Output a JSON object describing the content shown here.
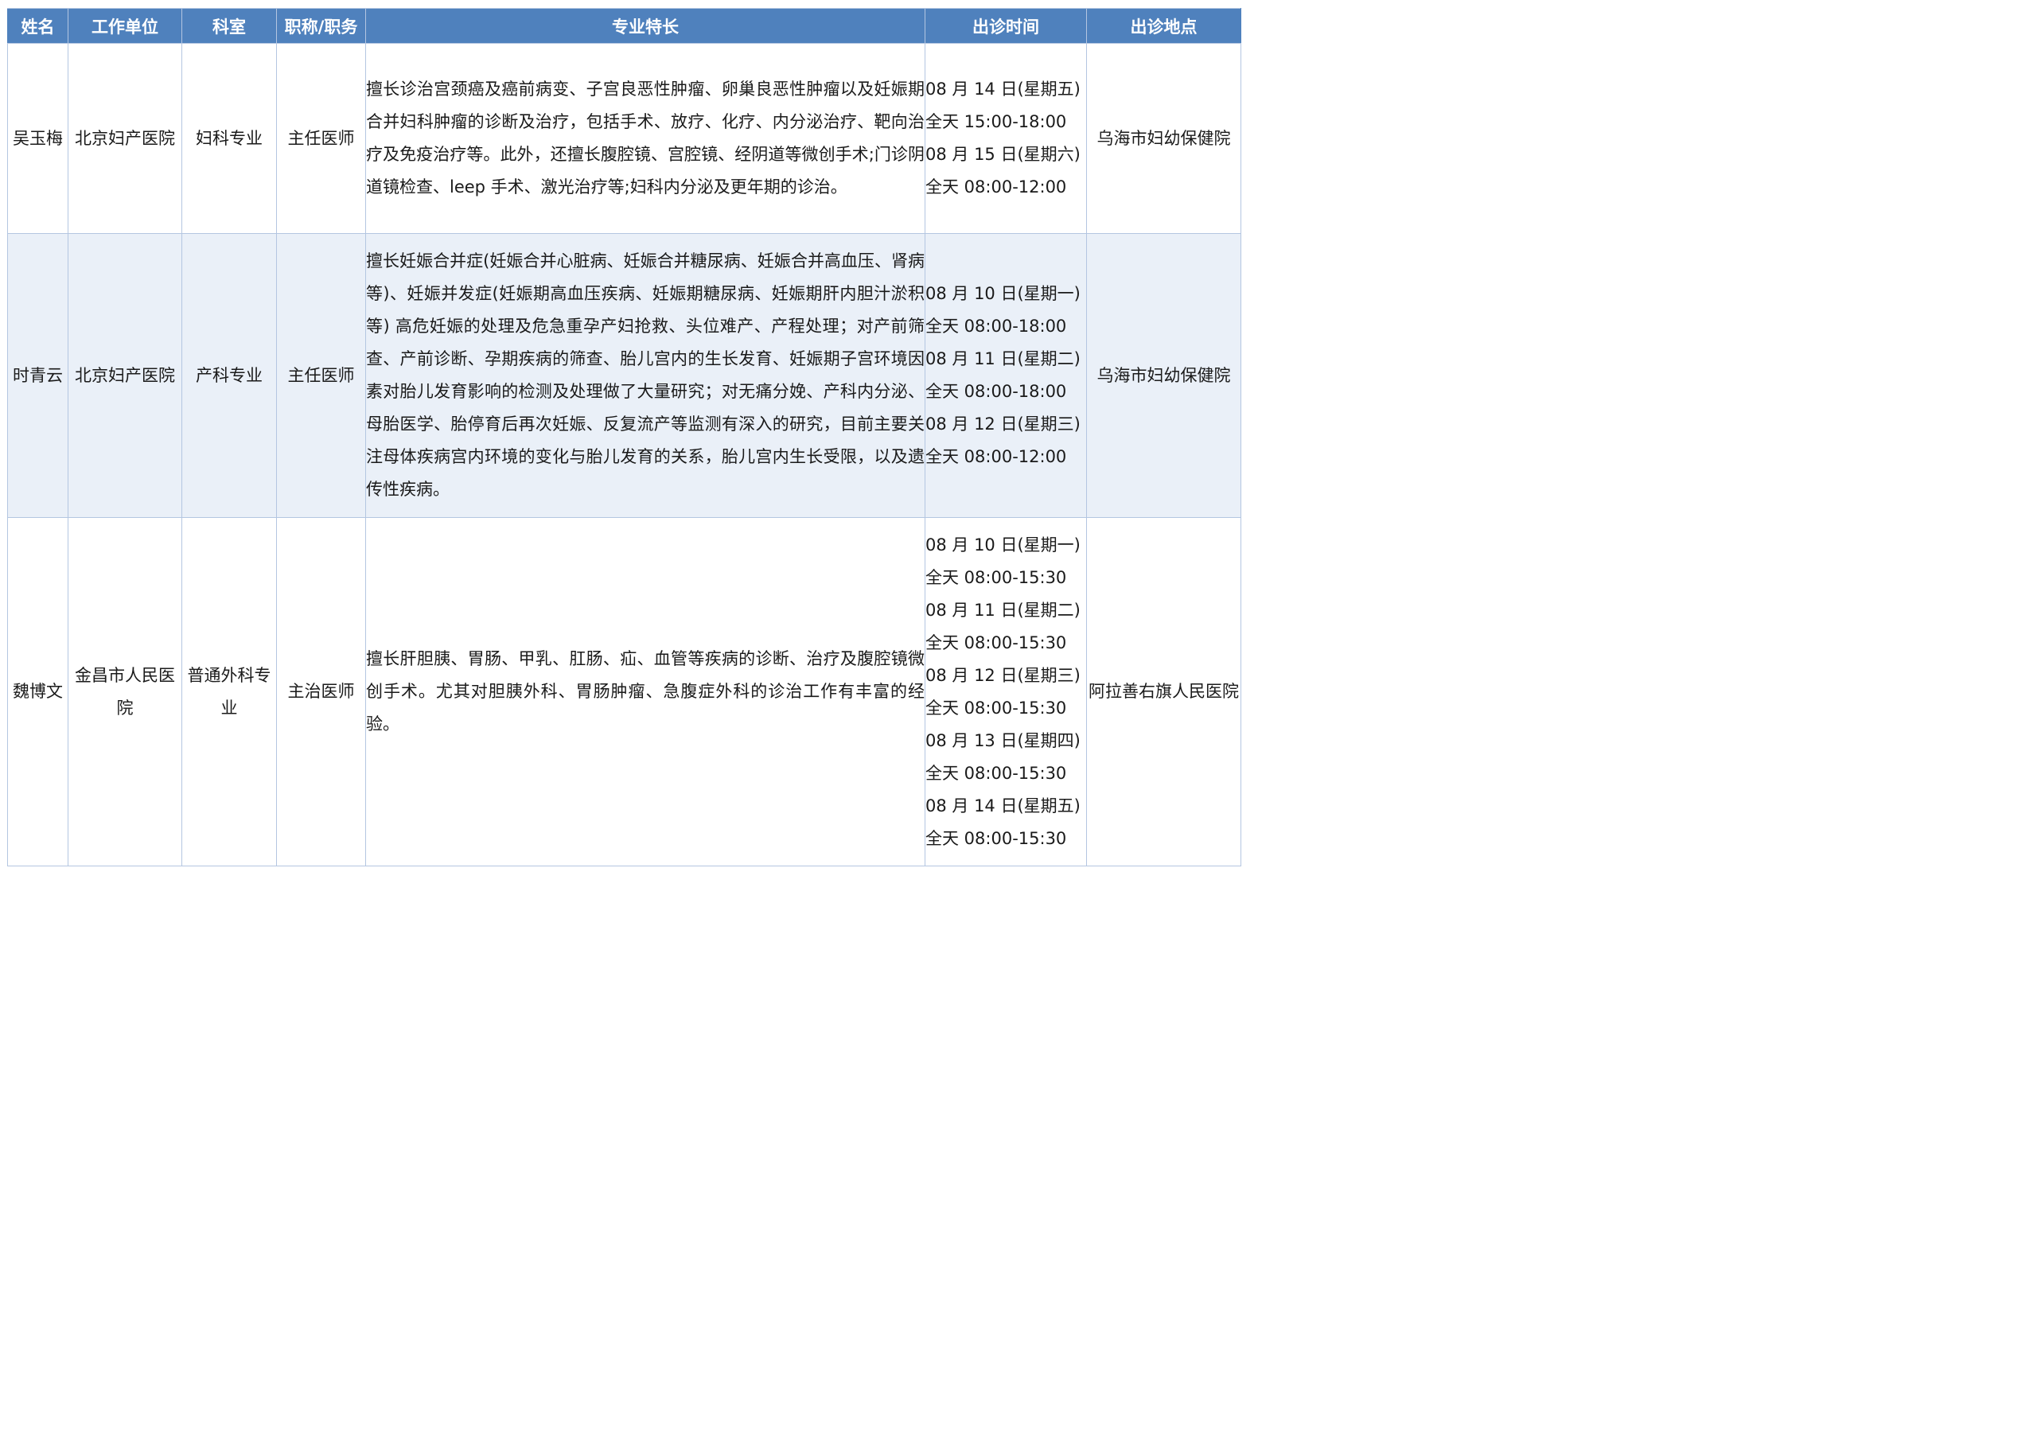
{
  "columns": [
    "姓名",
    "工作单位",
    "科室",
    "职称/职务",
    "专业特长",
    "出诊时间",
    "出诊地点"
  ],
  "doctors": [
    {
      "name": "吴玉梅",
      "unit": "北京妇产医院",
      "department": "妇科专业",
      "title": "主任医师",
      "specialty": "擅长诊治宫颈癌及癌前病变、子宫良恶性肿瘤、卵巢良恶性肿瘤以及妊娠期合并妇科肿瘤的诊断及治疗，包括手术、放疗、化疗、内分泌治疗、靶向治疗及免疫治疗等。此外，还擅长腹腔镜、宫腔镜、经阴道等微创手术;门诊阴道镜检查、leep 手术、激光治疗等;妇科内分泌及更年期的诊治。",
      "schedule": [
        "08 月 14 日(星期五)",
        "全天 15:00-18:00",
        "08 月 15 日(星期六)",
        "全天 08:00-12:00"
      ],
      "location": "乌海市妇幼保健院"
    },
    {
      "name": "时青云",
      "unit": "北京妇产医院",
      "department": "产科专业",
      "title": "主任医师",
      "specialty": "擅长妊娠合并症(妊娠合并心脏病、妊娠合并糖尿病、妊娠合并高血压、肾病等)、妊娠并发症(妊娠期高血压疾病、妊娠期糖尿病、妊娠期肝内胆汁淤积等) 高危妊娠的处理及危急重孕产妇抢救、头位难产、产程处理；对产前筛查、产前诊断、孕期疾病的筛查、胎儿宫内的生长发育、妊娠期子宫环境因素对胎儿发育影响的检测及处理做了大量研究；对无痛分娩、产科内分泌、母胎医学、胎停育后再次妊娠、反复流产等监测有深入的研究，目前主要关注母体疾病宫内环境的变化与胎儿发育的关系，胎儿宫内生长受限，以及遗传性疾病。",
      "schedule": [
        "08 月 10 日(星期一)",
        "全天 08:00-18:00",
        "08 月 11 日(星期二)",
        "全天 08:00-18:00",
        "08 月 12 日(星期三)",
        "全天 08:00-12:00"
      ],
      "location": "乌海市妇幼保健院"
    },
    {
      "name": "魏博文",
      "unit": "金昌市人民医院",
      "department": "普通外科专业",
      "title": "主治医师",
      "specialty": "擅长肝胆胰、胃肠、甲乳、肛肠、疝、血管等疾病的诊断、治疗及腹腔镜微创手术。尤其对胆胰外科、胃肠肿瘤、急腹症外科的诊治工作有丰富的经验。",
      "schedule": [
        "08 月 10 日(星期一)",
        "全天 08:00-15:30",
        "08 月 11 日(星期二)",
        "全天 08:00-15:30",
        "08 月 12 日(星期三)",
        "全天 08:00-15:30",
        "08 月 13 日(星期四)",
        "全天 08:00-15:30",
        "08 月 14 日(星期五)",
        "全天 08:00-15:30"
      ],
      "location": "阿拉善右旗人民医院"
    }
  ],
  "colors": {
    "header_bg": "#4f81bd",
    "header_text": "#ffffff",
    "alt_row_bg": "#eaf0f8",
    "grid_line": "#b4c6e1"
  }
}
